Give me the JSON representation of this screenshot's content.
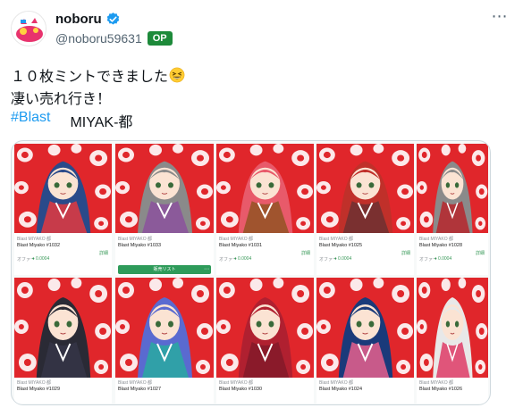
{
  "tweet": {
    "display_name": "noboru",
    "handle": "@noboru59631",
    "op_badge": "OP",
    "line1": "１０枚ミントできました",
    "line2": "凄い売れ行き！",
    "hashtag": "#Blast",
    "tag2": "MIYAK-都",
    "emoji": "grinning-squinting-face"
  },
  "colors": {
    "verified": "#1d9bf0",
    "op_badge": "#1d8a3a",
    "hashtag": "#1d9bf0",
    "pattern_red": "#e0262b",
    "price_green": "#3a9a5a"
  },
  "nft_cards": [
    {
      "collection": "Blast MIYAKO 都",
      "name": "Blast Miyako #1032",
      "detail": "詳細",
      "offer": "オファー",
      "price": "♦ 0.0004",
      "hair": "#2a4a8a",
      "robe": "#c73b4a"
    },
    {
      "collection": "Blast MIYAKO 都",
      "name": "Blast Miyako #1033",
      "detail": "",
      "offer": "",
      "price": "",
      "button": "販売リスト",
      "button_more": "⋯",
      "hair": "#8a8a8a",
      "robe": "#8b5a9a"
    },
    {
      "collection": "Blast MIYAKO 都",
      "name": "Blast Miyako #1031",
      "detail": "詳細",
      "offer": "オファー",
      "price": "♦ 0.0004",
      "hair": "#e85a6a",
      "robe": "#a0542e"
    },
    {
      "collection": "Blast MIYAKO 都",
      "name": "Blast Miyako #1025",
      "detail": "詳細",
      "offer": "オファー",
      "price": "♦ 0.0004",
      "hair": "#c0302a",
      "robe": "#7a3030"
    },
    {
      "collection": "Blast MIYAKO 都",
      "name": "Blast Miyako #1028",
      "detail": "詳細",
      "offer": "オファー",
      "price": "♦ 0.0004",
      "hair": "#8a8a8a",
      "robe": "#b0353a"
    },
    {
      "collection": "Blast MIYAKO 都",
      "name": "Blast Miyako #1029",
      "hair": "#2a2a35",
      "robe": "#333344"
    },
    {
      "collection": "Blast MIYAKO 都",
      "name": "Blast Miyako #1027",
      "hair": "#5a6ad0",
      "robe": "#30a0a8"
    },
    {
      "collection": "Blast MIYAKO 都",
      "name": "Blast Miyako #1030",
      "hair": "#b02030",
      "robe": "#8a1a2a"
    },
    {
      "collection": "Blast MIYAKO 都",
      "name": "Blast Miyako #1024",
      "hair": "#1a3a7a",
      "robe": "#c85a8a"
    },
    {
      "collection": "Blast MIYAKO 都",
      "name": "Blast Miyako #1026",
      "hair": "#e8e8e8",
      "robe": "#e0557a"
    }
  ]
}
